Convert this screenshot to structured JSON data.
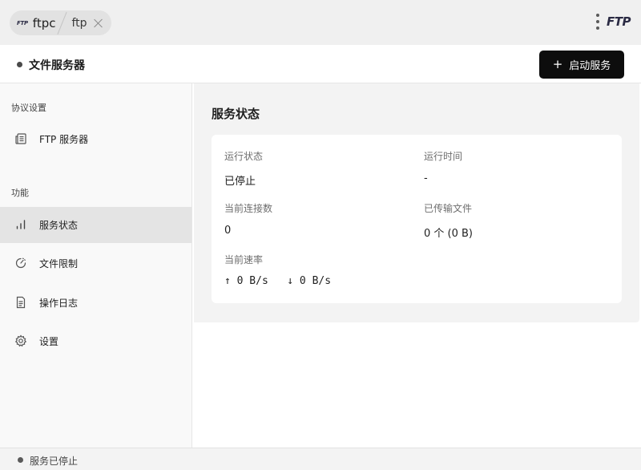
{
  "tabs": {
    "logo": "FTP",
    "active_label": "ftpc",
    "second_label": "ftp"
  },
  "brand": "FTP",
  "header": {
    "title": "文件服务器",
    "start_button": "启动服务"
  },
  "sidebar": {
    "section_protocol": "协议设置",
    "section_features": "功能",
    "items": [
      {
        "label": "FTP 服务器",
        "icon": "server-doc-icon"
      },
      {
        "label": "服务状态",
        "icon": "bar-chart-icon",
        "active": true
      },
      {
        "label": "文件限制",
        "icon": "gauge-icon"
      },
      {
        "label": "操作日志",
        "icon": "document-icon"
      },
      {
        "label": "设置",
        "icon": "gear-icon"
      }
    ]
  },
  "main": {
    "title": "服务状态",
    "stats": {
      "run_state_label": "运行状态",
      "run_state_value": "已停止",
      "run_time_label": "运行时间",
      "run_time_value": "-",
      "connections_label": "当前连接数",
      "connections_value": "0",
      "transferred_label": "已传输文件",
      "transferred_value": "0 个 (0 B)",
      "speed_label": "当前速率",
      "speed_value": "↑ 0 B/s   ↓ 0 B/s"
    }
  },
  "footer": {
    "status": "服务已停止"
  },
  "colors": {
    "accent": "#0d0d0d",
    "active_item_bg": "#e4e4e4",
    "topbar_bg": "#f0f0f0"
  }
}
